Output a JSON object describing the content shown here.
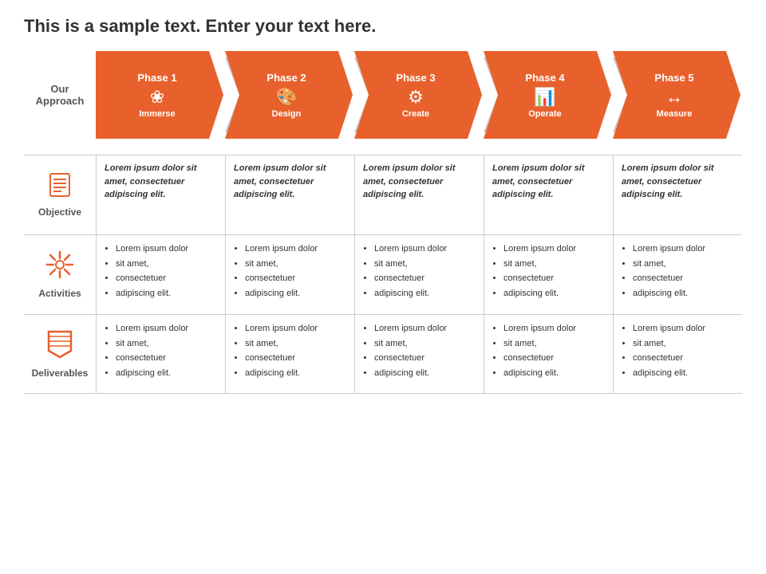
{
  "title": "This is a sample text. Enter your text here.",
  "approach_label": "Our\nApproach",
  "phases": [
    {
      "label": "Phase 1",
      "name": "Immerse",
      "icon": "❀",
      "color": "#e8612c"
    },
    {
      "label": "Phase 2",
      "name": "Design",
      "icon": "🎨",
      "color": "#e8612c"
    },
    {
      "label": "Phase 3",
      "name": "Create",
      "icon": "⚙",
      "color": "#e8612c"
    },
    {
      "label": "Phase 4",
      "name": "Operate",
      "icon": "📊",
      "color": "#e8612c"
    },
    {
      "label": "Phase 5",
      "name": "Measure",
      "icon": "↔",
      "color": "#e8612c"
    }
  ],
  "rows": [
    {
      "id": "objective",
      "label": "Objective",
      "icon_unicode": "☰",
      "cells": [
        "Lorem ipsum dolor sit amet, consectetuer adipiscing elit.",
        "Lorem ipsum dolor sit amet, consectetuer adipiscing elit.",
        "Lorem ipsum dolor sit amet, consectetuer adipiscing elit.",
        "Lorem ipsum dolor sit amet, consectetuer adipiscing elit.",
        "Lorem ipsum dolor sit amet, consectetuer adipiscing elit."
      ]
    },
    {
      "id": "activities",
      "label": "Activities",
      "icon_unicode": "✳",
      "cells": [
        [
          "Lorem ipsum dolor",
          "sit amet,",
          "consectetuer",
          "adipiscing elit."
        ],
        [
          "Lorem ipsum dolor",
          "sit amet,",
          "consectetuer",
          "adipiscing elit."
        ],
        [
          "Lorem ipsum dolor",
          "sit amet,",
          "consectetuer",
          "adipiscing elit."
        ],
        [
          "Lorem ipsum dolor",
          "sit amet,",
          "consectetuer",
          "adipiscing elit."
        ],
        [
          "Lorem ipsum dolor",
          "sit amet,",
          "consectetuer",
          "adipiscing elit."
        ]
      ]
    },
    {
      "id": "deliverables",
      "label": "Deliverables",
      "icon_unicode": "⏳",
      "cells": [
        [
          "Lorem ipsum dolor",
          "sit amet,",
          "consectetuer",
          "adipiscing elit."
        ],
        [
          "Lorem ipsum dolor",
          "sit amet,",
          "consectetuer",
          "adipiscing elit."
        ],
        [
          "Lorem ipsum dolor",
          "sit amet,",
          "consectetuer",
          "adipiscing elit."
        ],
        [
          "Lorem ipsum dolor",
          "sit amet,",
          "consectetuer",
          "adipiscing elit."
        ],
        [
          "Lorem ipsum dolor",
          "sit amet,",
          "consectetuer",
          "adipiscing elit."
        ]
      ]
    }
  ],
  "colors": {
    "orange": "#e8612c",
    "gray": "#b0b0b0",
    "gray_chevron": "#c8c8c8"
  }
}
